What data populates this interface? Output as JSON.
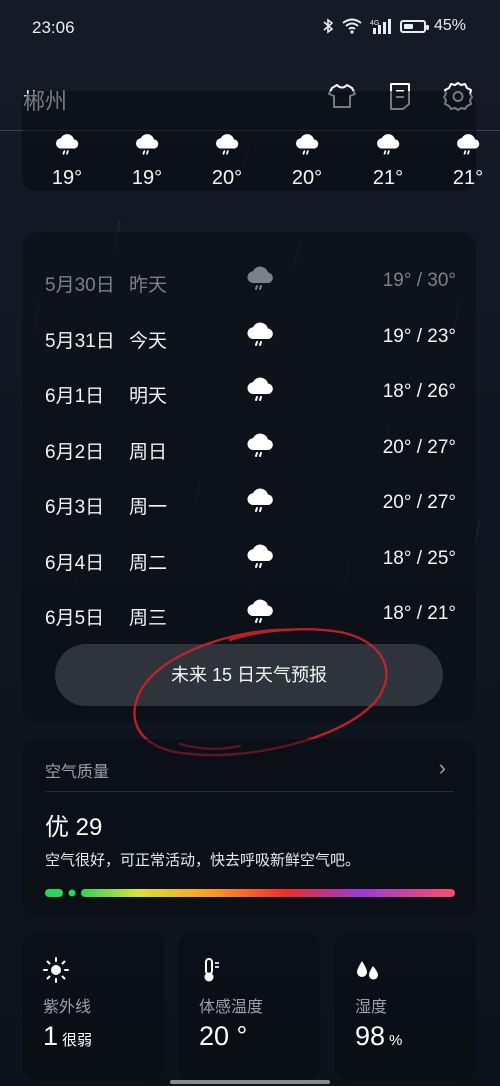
{
  "status": {
    "time": "23:06",
    "battery": "45%",
    "network": "4G"
  },
  "header": {
    "city": "郴州"
  },
  "hourly": [
    {
      "temp": "19°",
      "icon": "rain-cloud-icon"
    },
    {
      "temp": "19°",
      "icon": "rain-cloud-icon"
    },
    {
      "temp": "20°",
      "icon": "rain-cloud-icon"
    },
    {
      "temp": "20°",
      "icon": "rain-cloud-icon"
    },
    {
      "temp": "21°",
      "icon": "rain-cloud-icon"
    },
    {
      "temp": "21°",
      "icon": "rain-cloud-icon"
    }
  ],
  "forecast": [
    {
      "date": "5月30日",
      "day": "昨天",
      "temp": "19° / 30°",
      "past": true
    },
    {
      "date": "5月31日",
      "day": "今天",
      "temp": "19° / 23°"
    },
    {
      "date": "6月1日",
      "day": "明天",
      "temp": "18° / 26°"
    },
    {
      "date": "6月2日",
      "day": "周日",
      "temp": "20° / 27°"
    },
    {
      "date": "6月3日",
      "day": "周一",
      "temp": "20° / 27°"
    },
    {
      "date": "6月4日",
      "day": "周二",
      "temp": "18° / 25°"
    },
    {
      "date": "6月5日",
      "day": "周三",
      "temp": "18° / 21°"
    }
  ],
  "more_button": "未来 15 日天气预报",
  "air_quality": {
    "title": "空气质量",
    "level": "优 29",
    "description": "空气很好，可正常活动，快去呼吸新鲜空气吧。",
    "index_fraction": 0.06
  },
  "tiles": {
    "uv": {
      "label": "紫外线",
      "value": "1",
      "unit": "很弱"
    },
    "feels": {
      "label": "体感温度",
      "value": "20 °",
      "unit": ""
    },
    "humidity": {
      "label": "湿度",
      "value": "98",
      "unit": "%"
    }
  },
  "colors": {
    "accent_annotation": "#c8232c",
    "aqi_good": "#2bd45a"
  }
}
